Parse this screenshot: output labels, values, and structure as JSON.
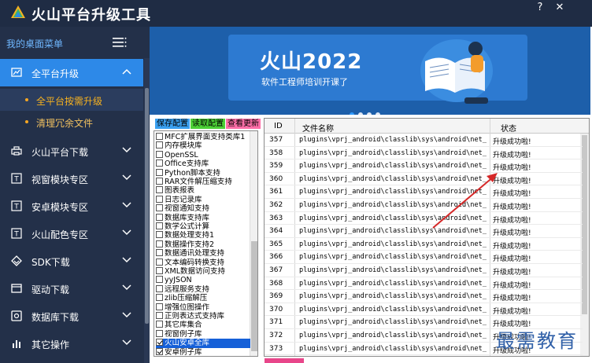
{
  "app": {
    "title": "火山平台升级工具",
    "help_label": "?",
    "close_label": "✕",
    "colors": {
      "titlebar": "#1f2c44",
      "sidebar": "#233049",
      "accent": "#2d89e8",
      "sub_text": "#f5b120"
    }
  },
  "sidebar": {
    "menu_title": "我的桌面菜单",
    "items": [
      {
        "label": "全平台升级",
        "icon": "chart-icon",
        "expanded": true
      },
      {
        "label": "火山平台下载",
        "icon": "printer-icon"
      },
      {
        "label": "视窗模块专区",
        "icon": "module-t-icon"
      },
      {
        "label": "安卓模块专区",
        "icon": "module-t-icon"
      },
      {
        "label": "火山配色专区",
        "icon": "module-t-icon"
      },
      {
        "label": "SDK下载",
        "icon": "diamond-icon"
      },
      {
        "label": "驱动下载",
        "icon": "window-icon"
      },
      {
        "label": "数据库下载",
        "icon": "disk-icon"
      },
      {
        "label": "其它操作",
        "icon": "bars-icon"
      }
    ],
    "sub_items": [
      {
        "label": "全平台按需升级",
        "active": true
      },
      {
        "label": "清理冗余文件",
        "active": false
      }
    ]
  },
  "banner": {
    "headline": "火山2022",
    "subline": "软件工程师培训开课了",
    "slide_count": 4,
    "active_slide": 1
  },
  "toolbar": {
    "save_label": "保存配置",
    "read_label": "读取配置",
    "update_label": "查看更新"
  },
  "checklist": {
    "items": [
      {
        "label": "MFC扩展界面支持类库1",
        "checked": false
      },
      {
        "label": "内存模块库",
        "checked": false
      },
      {
        "label": "OpenSSL",
        "checked": false
      },
      {
        "label": "Office支持库",
        "checked": false
      },
      {
        "label": "Python脚本支持",
        "checked": false
      },
      {
        "label": "RAR文件解压缩支持",
        "checked": false
      },
      {
        "label": "图表报表",
        "checked": false
      },
      {
        "label": "日志记录库",
        "checked": false
      },
      {
        "label": "视窗通知支持",
        "checked": false
      },
      {
        "label": "数据库支持库",
        "checked": false
      },
      {
        "label": "数学公式计算",
        "checked": false
      },
      {
        "label": "数据处理支持1",
        "checked": false
      },
      {
        "label": "数据操作支持2",
        "checked": false
      },
      {
        "label": "数据通讯处理支持",
        "checked": false
      },
      {
        "label": "文本编码转换支持",
        "checked": false
      },
      {
        "label": "XML数据访问支持",
        "checked": false
      },
      {
        "label": "yyJSON",
        "checked": false
      },
      {
        "label": "远程服务支持",
        "checked": false
      },
      {
        "label": "zlib压缩解压",
        "checked": false
      },
      {
        "label": "增强位图操作",
        "checked": false
      },
      {
        "label": "正则表达式支持库",
        "checked": false
      },
      {
        "label": "其它库集合",
        "checked": false
      },
      {
        "label": "视窗例子库",
        "checked": false
      },
      {
        "label": "火山安卓全库",
        "checked": true,
        "selected": true
      },
      {
        "label": "安卓例子库",
        "checked": true
      }
    ]
  },
  "grid": {
    "columns": [
      "ID",
      "文件名称",
      "状态"
    ],
    "rows": [
      {
        "id": "357",
        "file": "plugins\\vprj_android\\classlib\\sys\\android\\net_msg_...",
        "status": "升级成功啦!"
      },
      {
        "id": "358",
        "file": "plugins\\vprj_android\\classlib\\sys\\android\\net_msg_...",
        "status": "升级成功啦!"
      },
      {
        "id": "359",
        "file": "plugins\\vprj_android\\classlib\\sys\\android\\net_msg_...",
        "status": "升级成功啦!"
      },
      {
        "id": "360",
        "file": "plugins\\vprj_android\\classlib\\sys\\android\\net_msg_...",
        "status": "升级成功啦!"
      },
      {
        "id": "361",
        "file": "plugins\\vprj_android\\classlib\\sys\\android\\net_msg_...",
        "status": "升级成功啦!"
      },
      {
        "id": "362",
        "file": "plugins\\vprj_android\\classlib\\sys\\android\\net_msg_...",
        "status": "升级成功啦!"
      },
      {
        "id": "363",
        "file": "plugins\\vprj_android\\classlib\\sys\\android\\net_msg_...",
        "status": "升级成功啦!"
      },
      {
        "id": "364",
        "file": "plugins\\vprj_android\\classlib\\sys\\android\\net_msg_...",
        "status": "升级成功啦!"
      },
      {
        "id": "365",
        "file": "plugins\\vprj_android\\classlib\\sys\\android\\net_msg_...",
        "status": "升级成功啦!"
      },
      {
        "id": "366",
        "file": "plugins\\vprj_android\\classlib\\sys\\android\\net_msg_...",
        "status": "升级成功啦!"
      },
      {
        "id": "367",
        "file": "plugins\\vprj_android\\classlib\\sys\\android\\net_msg_...",
        "status": "升级成功啦!"
      },
      {
        "id": "368",
        "file": "plugins\\vprj_android\\classlib\\sys\\android\\net_msg_...",
        "status": "升级成功啦!"
      },
      {
        "id": "369",
        "file": "plugins\\vprj_android\\classlib\\sys\\android\\net_msg_...",
        "status": "升级成功啦!"
      },
      {
        "id": "370",
        "file": "plugins\\vprj_android\\classlib\\sys\\android\\net_msg_...",
        "status": "升级成功啦!"
      },
      {
        "id": "371",
        "file": "plugins\\vprj_android\\classlib\\sys\\android\\net_msg_...",
        "status": "升级成功啦!"
      },
      {
        "id": "372",
        "file": "plugins\\vprj_android\\classlib\\sys\\android\\net_msg_...",
        "status": "升级成功啦!"
      },
      {
        "id": "373",
        "file": "plugins\\vprj_android\\classlib\\sys\\android\\net_msg_...",
        "status": "升级成功啦!"
      }
    ]
  },
  "watermark": "最需教育"
}
